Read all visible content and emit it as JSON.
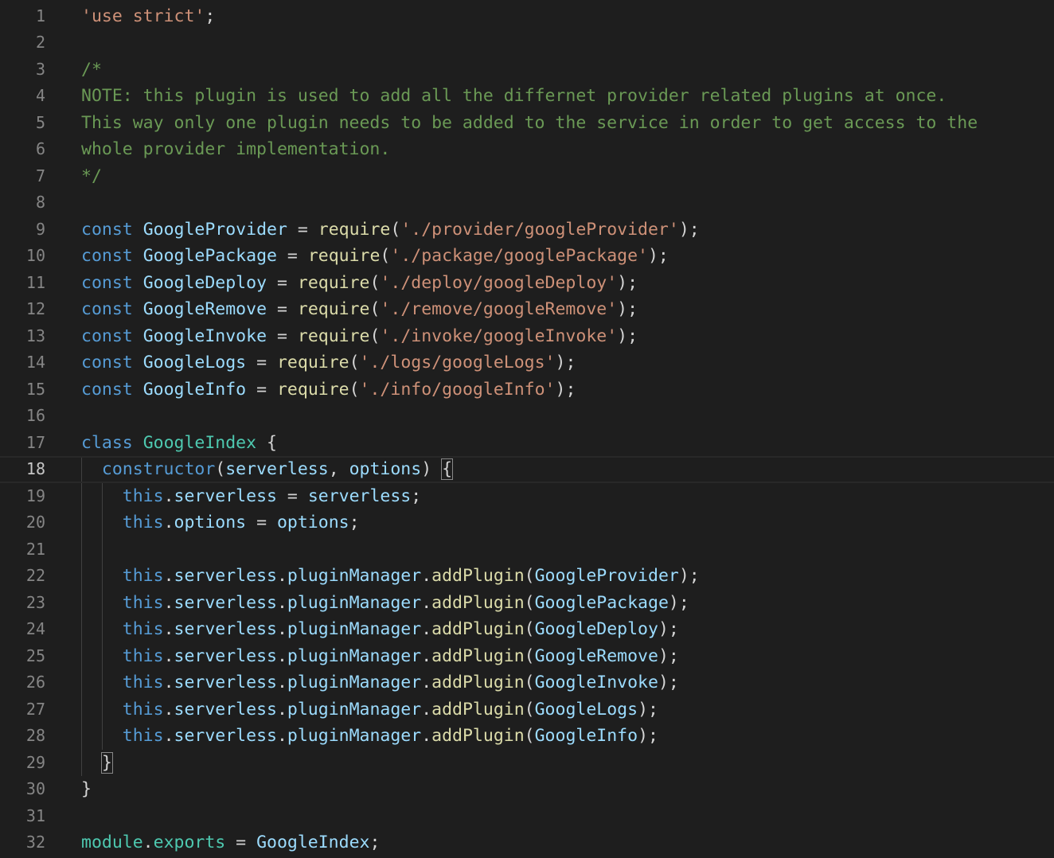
{
  "editor": {
    "theme": {
      "background": "#1e1e1e",
      "default": "#d4d4d4",
      "line_number": "#858585",
      "line_number_active": "#c6c6c6",
      "keyword": "#569cd6",
      "string": "#ce9178",
      "comment": "#6a9955",
      "function": "#dcdcaa",
      "variable": "#9cdcfe",
      "class": "#4ec9b0"
    },
    "active_line": 18,
    "lines": [
      {
        "n": 1,
        "tokens": [
          [
            "'use strict'",
            "string"
          ],
          [
            ";",
            "default"
          ]
        ]
      },
      {
        "n": 2,
        "tokens": []
      },
      {
        "n": 3,
        "tokens": [
          [
            "/*",
            "comment"
          ]
        ]
      },
      {
        "n": 4,
        "tokens": [
          [
            "NOTE: this plugin is used to add all the differnet provider related plugins at once.",
            "comment"
          ]
        ]
      },
      {
        "n": 5,
        "tokens": [
          [
            "This way only one plugin needs to be added to the service in order to get access to the",
            "comment"
          ]
        ]
      },
      {
        "n": 6,
        "tokens": [
          [
            "whole provider implementation.",
            "comment"
          ]
        ]
      },
      {
        "n": 7,
        "tokens": [
          [
            "*/",
            "comment"
          ]
        ]
      },
      {
        "n": 8,
        "tokens": []
      },
      {
        "n": 9,
        "tokens": [
          [
            "const",
            "keyword"
          ],
          [
            " ",
            "default"
          ],
          [
            "GoogleProvider",
            "variable"
          ],
          [
            " = ",
            "default"
          ],
          [
            "require",
            "function"
          ],
          [
            "(",
            "default"
          ],
          [
            "'./provider/googleProvider'",
            "string"
          ],
          [
            ");",
            "default"
          ]
        ]
      },
      {
        "n": 10,
        "tokens": [
          [
            "const",
            "keyword"
          ],
          [
            " ",
            "default"
          ],
          [
            "GooglePackage",
            "variable"
          ],
          [
            " = ",
            "default"
          ],
          [
            "require",
            "function"
          ],
          [
            "(",
            "default"
          ],
          [
            "'./package/googlePackage'",
            "string"
          ],
          [
            ");",
            "default"
          ]
        ]
      },
      {
        "n": 11,
        "tokens": [
          [
            "const",
            "keyword"
          ],
          [
            " ",
            "default"
          ],
          [
            "GoogleDeploy",
            "variable"
          ],
          [
            " = ",
            "default"
          ],
          [
            "require",
            "function"
          ],
          [
            "(",
            "default"
          ],
          [
            "'./deploy/googleDeploy'",
            "string"
          ],
          [
            ");",
            "default"
          ]
        ]
      },
      {
        "n": 12,
        "tokens": [
          [
            "const",
            "keyword"
          ],
          [
            " ",
            "default"
          ],
          [
            "GoogleRemove",
            "variable"
          ],
          [
            " = ",
            "default"
          ],
          [
            "require",
            "function"
          ],
          [
            "(",
            "default"
          ],
          [
            "'./remove/googleRemove'",
            "string"
          ],
          [
            ");",
            "default"
          ]
        ]
      },
      {
        "n": 13,
        "tokens": [
          [
            "const",
            "keyword"
          ],
          [
            " ",
            "default"
          ],
          [
            "GoogleInvoke",
            "variable"
          ],
          [
            " = ",
            "default"
          ],
          [
            "require",
            "function"
          ],
          [
            "(",
            "default"
          ],
          [
            "'./invoke/googleInvoke'",
            "string"
          ],
          [
            ");",
            "default"
          ]
        ]
      },
      {
        "n": 14,
        "tokens": [
          [
            "const",
            "keyword"
          ],
          [
            " ",
            "default"
          ],
          [
            "GoogleLogs",
            "variable"
          ],
          [
            " = ",
            "default"
          ],
          [
            "require",
            "function"
          ],
          [
            "(",
            "default"
          ],
          [
            "'./logs/googleLogs'",
            "string"
          ],
          [
            ");",
            "default"
          ]
        ]
      },
      {
        "n": 15,
        "tokens": [
          [
            "const",
            "keyword"
          ],
          [
            " ",
            "default"
          ],
          [
            "GoogleInfo",
            "variable"
          ],
          [
            " = ",
            "default"
          ],
          [
            "require",
            "function"
          ],
          [
            "(",
            "default"
          ],
          [
            "'./info/googleInfo'",
            "string"
          ],
          [
            ");",
            "default"
          ]
        ]
      },
      {
        "n": 16,
        "tokens": []
      },
      {
        "n": 17,
        "tokens": [
          [
            "class",
            "keyword"
          ],
          [
            " ",
            "default"
          ],
          [
            "GoogleIndex",
            "class"
          ],
          [
            " {",
            "default"
          ]
        ]
      },
      {
        "n": 18,
        "tokens": [
          [
            "  ",
            "default"
          ],
          [
            "constructor",
            "keyword"
          ],
          [
            "(",
            "default"
          ],
          [
            "serverless",
            "variable"
          ],
          [
            ", ",
            "default"
          ],
          [
            "options",
            "variable"
          ],
          [
            ") ",
            "default"
          ],
          [
            "{",
            "bracket"
          ]
        ]
      },
      {
        "n": 19,
        "tokens": [
          [
            "    ",
            "default"
          ],
          [
            "this",
            "keyword"
          ],
          [
            ".",
            "default"
          ],
          [
            "serverless",
            "variable"
          ],
          [
            " = ",
            "default"
          ],
          [
            "serverless",
            "variable"
          ],
          [
            ";",
            "default"
          ]
        ]
      },
      {
        "n": 20,
        "tokens": [
          [
            "    ",
            "default"
          ],
          [
            "this",
            "keyword"
          ],
          [
            ".",
            "default"
          ],
          [
            "options",
            "variable"
          ],
          [
            " = ",
            "default"
          ],
          [
            "options",
            "variable"
          ],
          [
            ";",
            "default"
          ]
        ]
      },
      {
        "n": 21,
        "tokens": []
      },
      {
        "n": 22,
        "tokens": [
          [
            "    ",
            "default"
          ],
          [
            "this",
            "keyword"
          ],
          [
            ".",
            "default"
          ],
          [
            "serverless",
            "variable"
          ],
          [
            ".",
            "default"
          ],
          [
            "pluginManager",
            "variable"
          ],
          [
            ".",
            "default"
          ],
          [
            "addPlugin",
            "function"
          ],
          [
            "(",
            "default"
          ],
          [
            "GoogleProvider",
            "variable"
          ],
          [
            ");",
            "default"
          ]
        ]
      },
      {
        "n": 23,
        "tokens": [
          [
            "    ",
            "default"
          ],
          [
            "this",
            "keyword"
          ],
          [
            ".",
            "default"
          ],
          [
            "serverless",
            "variable"
          ],
          [
            ".",
            "default"
          ],
          [
            "pluginManager",
            "variable"
          ],
          [
            ".",
            "default"
          ],
          [
            "addPlugin",
            "function"
          ],
          [
            "(",
            "default"
          ],
          [
            "GooglePackage",
            "variable"
          ],
          [
            ");",
            "default"
          ]
        ]
      },
      {
        "n": 24,
        "tokens": [
          [
            "    ",
            "default"
          ],
          [
            "this",
            "keyword"
          ],
          [
            ".",
            "default"
          ],
          [
            "serverless",
            "variable"
          ],
          [
            ".",
            "default"
          ],
          [
            "pluginManager",
            "variable"
          ],
          [
            ".",
            "default"
          ],
          [
            "addPlugin",
            "function"
          ],
          [
            "(",
            "default"
          ],
          [
            "GoogleDeploy",
            "variable"
          ],
          [
            ");",
            "default"
          ]
        ]
      },
      {
        "n": 25,
        "tokens": [
          [
            "    ",
            "default"
          ],
          [
            "this",
            "keyword"
          ],
          [
            ".",
            "default"
          ],
          [
            "serverless",
            "variable"
          ],
          [
            ".",
            "default"
          ],
          [
            "pluginManager",
            "variable"
          ],
          [
            ".",
            "default"
          ],
          [
            "addPlugin",
            "function"
          ],
          [
            "(",
            "default"
          ],
          [
            "GoogleRemove",
            "variable"
          ],
          [
            ");",
            "default"
          ]
        ]
      },
      {
        "n": 26,
        "tokens": [
          [
            "    ",
            "default"
          ],
          [
            "this",
            "keyword"
          ],
          [
            ".",
            "default"
          ],
          [
            "serverless",
            "variable"
          ],
          [
            ".",
            "default"
          ],
          [
            "pluginManager",
            "variable"
          ],
          [
            ".",
            "default"
          ],
          [
            "addPlugin",
            "function"
          ],
          [
            "(",
            "default"
          ],
          [
            "GoogleInvoke",
            "variable"
          ],
          [
            ");",
            "default"
          ]
        ]
      },
      {
        "n": 27,
        "tokens": [
          [
            "    ",
            "default"
          ],
          [
            "this",
            "keyword"
          ],
          [
            ".",
            "default"
          ],
          [
            "serverless",
            "variable"
          ],
          [
            ".",
            "default"
          ],
          [
            "pluginManager",
            "variable"
          ],
          [
            ".",
            "default"
          ],
          [
            "addPlugin",
            "function"
          ],
          [
            "(",
            "default"
          ],
          [
            "GoogleLogs",
            "variable"
          ],
          [
            ");",
            "default"
          ]
        ]
      },
      {
        "n": 28,
        "tokens": [
          [
            "    ",
            "default"
          ],
          [
            "this",
            "keyword"
          ],
          [
            ".",
            "default"
          ],
          [
            "serverless",
            "variable"
          ],
          [
            ".",
            "default"
          ],
          [
            "pluginManager",
            "variable"
          ],
          [
            ".",
            "default"
          ],
          [
            "addPlugin",
            "function"
          ],
          [
            "(",
            "default"
          ],
          [
            "GoogleInfo",
            "variable"
          ],
          [
            ");",
            "default"
          ]
        ]
      },
      {
        "n": 29,
        "tokens": [
          [
            "  ",
            "default"
          ],
          [
            "}",
            "bracket"
          ]
        ]
      },
      {
        "n": 30,
        "tokens": [
          [
            "}",
            "default"
          ]
        ]
      },
      {
        "n": 31,
        "tokens": []
      },
      {
        "n": 32,
        "tokens": [
          [
            "module",
            "class"
          ],
          [
            ".",
            "default"
          ],
          [
            "exports",
            "class"
          ],
          [
            " = ",
            "default"
          ],
          [
            "GoogleIndex",
            "variable"
          ],
          [
            ";",
            "default"
          ]
        ]
      }
    ]
  }
}
